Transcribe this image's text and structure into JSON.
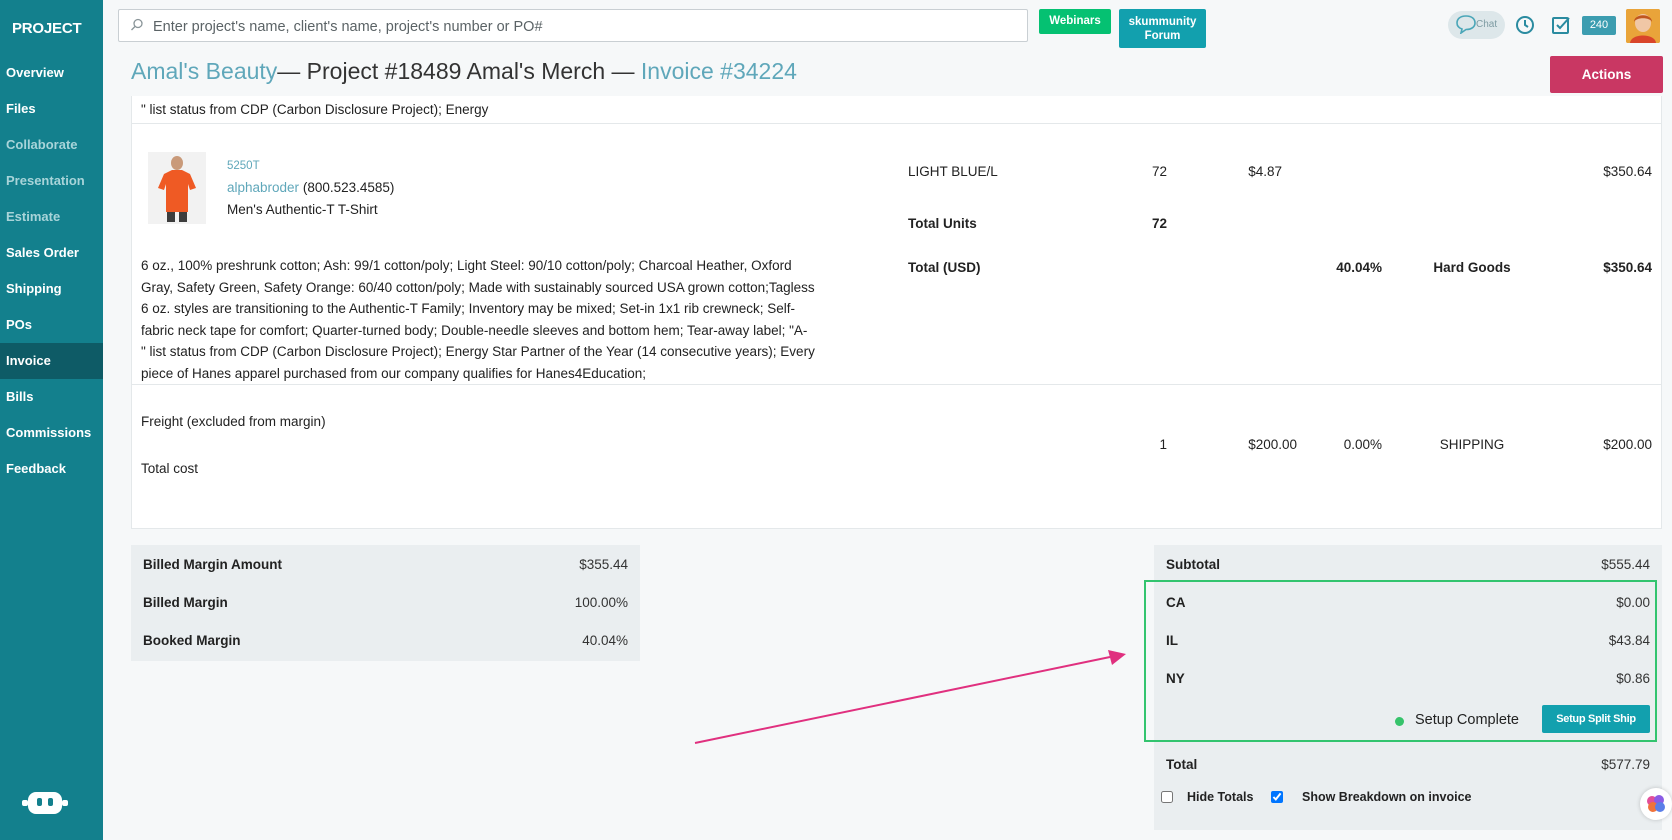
{
  "sidebar": {
    "brand": "PROJECT",
    "items": [
      {
        "label": "Overview"
      },
      {
        "label": "Files"
      },
      {
        "label": "Collaborate"
      },
      {
        "label": "Presentation"
      },
      {
        "label": "Estimate"
      },
      {
        "label": "Sales Order"
      },
      {
        "label": "Shipping"
      },
      {
        "label": "POs"
      },
      {
        "label": "Invoice"
      },
      {
        "label": "Bills"
      },
      {
        "label": "Commissions"
      },
      {
        "label": "Feedback"
      }
    ],
    "active": "Invoice"
  },
  "topbar": {
    "search_placeholder": "Enter project's name, client's name, project's number or PO#",
    "webinars_label": "Webinars",
    "forum_line1": "skummunity",
    "forum_line2": "Forum",
    "chat_label": "Chat",
    "notification_count": "240"
  },
  "header": {
    "client": "Amal's Beauty",
    "project": "— Project #18489 Amal's Merch — ",
    "invoice": "Invoice #34224",
    "actions_label": "Actions"
  },
  "invoice": {
    "top_desc_fragment": "\" list status from CDP (Carbon Disclosure Project); Energy",
    "item": {
      "sku": "5250T",
      "supplier": "alphabroder",
      "supplier_phone": "(800.523.4585)",
      "name": "Men's Authentic-T T-Shirt",
      "variant": "LIGHT BLUE/L",
      "variant_qty": "72",
      "variant_price": "$4.87",
      "variant_total": "$350.64",
      "total_units_label": "Total Units",
      "total_units": "72",
      "total_label": "Total (USD)",
      "margin": "40.04%",
      "category": "Hard Goods",
      "total": "$350.64",
      "description_lines": [
        "6 oz., 100% preshrunk cotton; Ash: 99/1 cotton/poly; Light Steel: 90/10 cotton/poly; Charcoal Heather, Oxford",
        "Gray, Safety Green, Safety Orange: 60/40 cotton/poly; Made with sustainably sourced USA grown cotton;Tagless",
        "6 oz. styles are transitioning to the Authentic-T Family; Inventory may be mixed; Set-in 1x1 rib crewneck; Self-",
        "fabric neck tape for comfort; Quarter-turned body; Double-needle sleeves and bottom hem; Tear-away label; \"A-",
        "\" list status from CDP (Carbon Disclosure Project); Energy Star Partner of the Year (14 consecutive years); Every",
        "piece of Hanes apparel purchased from our company qualifies for Hanes4Education;"
      ]
    },
    "freight": {
      "name": "Freight (excluded from margin)",
      "cost_label": "Total cost",
      "qty": "1",
      "price": "$200.00",
      "margin": "0.00%",
      "category": "SHIPPING",
      "total": "$200.00"
    }
  },
  "margins": {
    "billed_margin_amount_label": "Billed Margin Amount",
    "billed_margin_amount": "$355.44",
    "billed_margin_label": "Billed Margin",
    "billed_margin": "100.00%",
    "booked_margin_label": "Booked Margin",
    "booked_margin": "40.04%"
  },
  "totals": {
    "subtotal_label": "Subtotal",
    "subtotal": "$555.44",
    "taxes": [
      {
        "label": "CA",
        "value": "$0.00"
      },
      {
        "label": "IL",
        "value": "$43.84"
      },
      {
        "label": "NY",
        "value": "$0.86"
      }
    ],
    "status": "Setup Complete",
    "split_ship_label": "Setup Split Ship",
    "total_label": "Total",
    "total": "$577.79",
    "hide_totals_label": "Hide Totals",
    "hide_totals_checked": false,
    "show_breakdown_label": "Show Breakdown on invoice",
    "show_breakdown_checked": true
  },
  "colors": {
    "sidebar": "#13808d",
    "accent_link": "#5fa7ba",
    "actions": "#c93763",
    "highlight": "#33c46f",
    "arrow": "#e0307f"
  }
}
